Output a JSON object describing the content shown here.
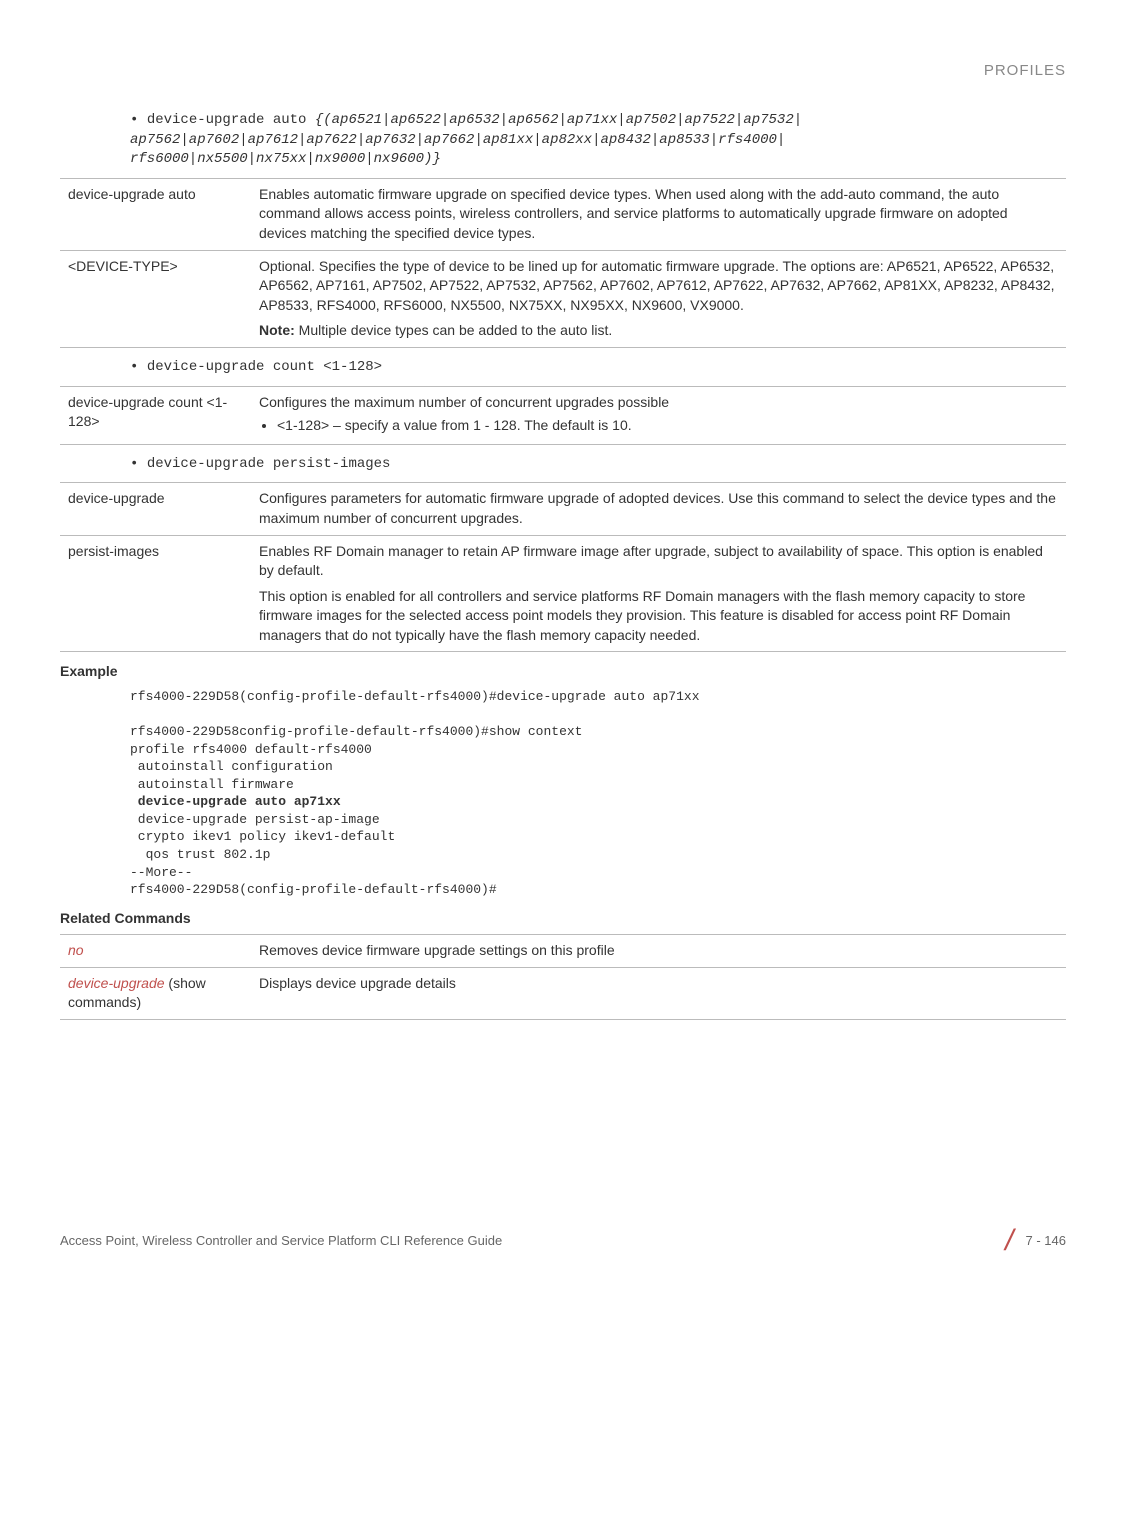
{
  "header": {
    "category": "PROFILES"
  },
  "cmd1": {
    "text": "device-upgrade auto {(ap6521|ap6522|ap6532|ap6562|ap71xx|ap7502|ap7522|ap7532|\nap7562|ap7602|ap7612|ap7622|ap7632|ap7662|ap81xx|ap82xx|ap8432|ap8533|rfs4000|\nrfs6000|nx5500|nx75xx|nx9000|nx9600)}"
  },
  "table1": {
    "row1": {
      "param": "device-upgrade auto",
      "desc": "Enables automatic firmware upgrade on specified device types. When used along with the add-auto command, the auto command allows access points, wireless controllers, and service platforms to automatically upgrade firmware on adopted devices matching the specified device types."
    },
    "row2": {
      "param": "<DEVICE-TYPE>",
      "desc": "Optional. Specifies the type of device to be lined up for automatic firmware upgrade. The options are: AP6521, AP6522, AP6532, AP6562, AP7161, AP7502, AP7522, AP7532, AP7562, AP7602, AP7612, AP7622, AP7632, AP7662, AP81XX, AP8232, AP8432, AP8533, RFS4000, RFS6000, NX5500, NX75XX, NX95XX, NX9600, VX9000.",
      "noteLabel": "Note:",
      "noteText": " Multiple device types can be added to the auto list."
    }
  },
  "cmd2": {
    "text": "device-upgrade count <1-128>"
  },
  "table2": {
    "row1": {
      "param": "device-upgrade count <1-128>",
      "desc": "Configures the maximum number of concurrent upgrades possible",
      "bullet": "<1-128> – specify a value from 1 - 128. The default is 10."
    }
  },
  "cmd3": {
    "text": "device-upgrade persist-images"
  },
  "table3": {
    "row1": {
      "param": "device-upgrade",
      "desc": "Configures parameters for automatic firmware upgrade of adopted devices. Use this command to select the device types and the maximum number of concurrent upgrades."
    },
    "row2": {
      "param": "persist-images",
      "desc1": "Enables RF Domain manager to retain AP firmware image after upgrade, subject to availability of space. This option is enabled by default.",
      "desc2": "This option is enabled for all controllers and service platforms RF Domain managers with the flash memory capacity to store firmware images for the selected access point models they provision. This feature is disabled for access point RF Domain managers that do not typically have the flash memory capacity needed."
    }
  },
  "example": {
    "heading": "Example",
    "line1": "rfs4000-229D58(config-profile-default-rfs4000)#device-upgrade auto ap71xx",
    "line2": "rfs4000-229D58config-profile-default-rfs4000)#show context",
    "line3": "profile rfs4000 default-rfs4000",
    "line4": " autoinstall configuration",
    "line5": " autoinstall firmware",
    "line6": " device-upgrade auto ap71xx",
    "line7": " device-upgrade persist-ap-image",
    "line8": " crypto ikev1 policy ikev1-default",
    "line9": "  qos trust 802.1p",
    "line10": "--More--",
    "line11": "rfs4000-229D58(config-profile-default-rfs4000)#"
  },
  "related": {
    "heading": "Related Commands",
    "row1": {
      "param": "no",
      "desc": "Removes device firmware upgrade settings on this profile"
    },
    "row2": {
      "paramLink": "device-upgrade",
      "paramRest": " (show commands)",
      "desc": "Displays device upgrade details"
    }
  },
  "footer": {
    "left": "Access Point, Wireless Controller and Service Platform CLI Reference Guide",
    "right": "7 - 146"
  }
}
